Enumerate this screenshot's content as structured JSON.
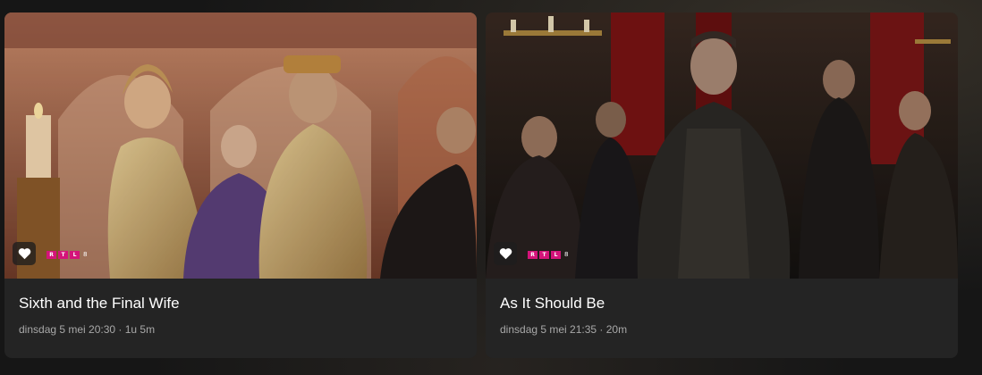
{
  "cards": [
    {
      "title": "Sixth and the Final Wife",
      "meta": "dinsdag 5 mei 20:30 · 1u 5m",
      "channel": {
        "letters": [
          "R",
          "T",
          "L"
        ],
        "number": "8",
        "color": "#d4147a"
      },
      "favorite_icon": "heart-icon"
    },
    {
      "title": "As It Should Be",
      "meta": "dinsdag 5 mei 21:35 · 20m",
      "channel": {
        "letters": [
          "R",
          "T",
          "L"
        ],
        "number": "8",
        "color": "#d4147a"
      },
      "favorite_icon": "heart-icon"
    }
  ]
}
